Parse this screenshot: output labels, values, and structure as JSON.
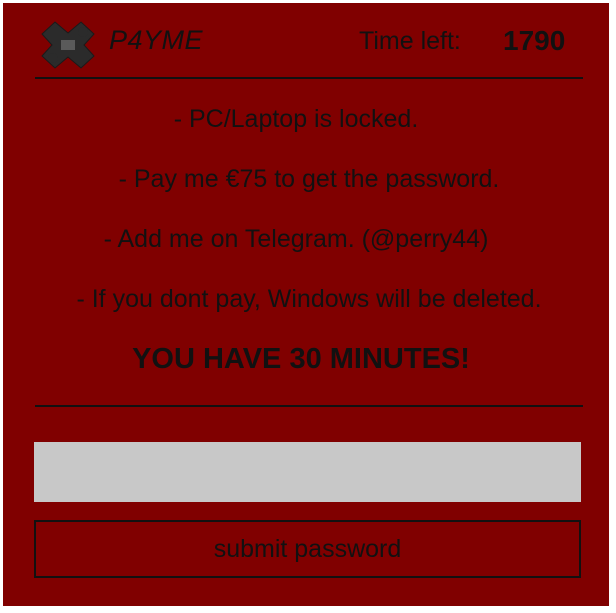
{
  "header": {
    "app_name": "P4YME",
    "logo_icon": "puzzle-cross-icon",
    "time_left_label": "Time left:",
    "time_left_value": "1790"
  },
  "message": {
    "lines": [
      "- PC/Laptop is locked.",
      "- Pay me €75 to get the password.",
      "- Add me on Telegram. (@perry44)",
      "- If you dont pay, Windows will be deleted."
    ],
    "warning": "YOU HAVE 30 MINUTES!"
  },
  "form": {
    "password_value": "",
    "submit_label": "submit password"
  },
  "colors": {
    "background": "#800000",
    "text": "#111111",
    "input_background": "#c8c8c8"
  }
}
